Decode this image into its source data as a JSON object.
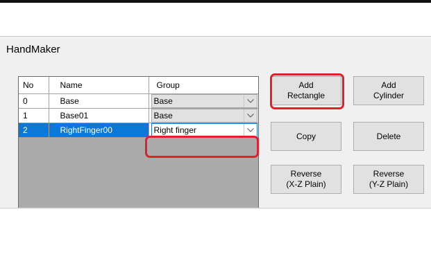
{
  "window": {
    "title": "HandMaker"
  },
  "table": {
    "columns": [
      "No",
      "Name",
      "Group"
    ],
    "rows": [
      {
        "no": "0",
        "name": "Base",
        "group": "Base"
      },
      {
        "no": "1",
        "name": "Base01",
        "group": "Base"
      },
      {
        "no": "2",
        "name": "RightFinger00",
        "group": "Right finger",
        "selected": true
      }
    ]
  },
  "buttons": {
    "add_rectangle": "Add\nRectangle",
    "add_cylinder": "Add\nCylinder",
    "copy": "Copy",
    "delete": "Delete",
    "reverse_xz": "Reverse\n(X-Z Plain)",
    "reverse_yz": "Reverse\n(Y-Z Plain)"
  },
  "colors": {
    "selection": "#0a78d7",
    "highlight": "#e3202a"
  },
  "icons": {
    "dropdown": "chevron-down-icon"
  }
}
